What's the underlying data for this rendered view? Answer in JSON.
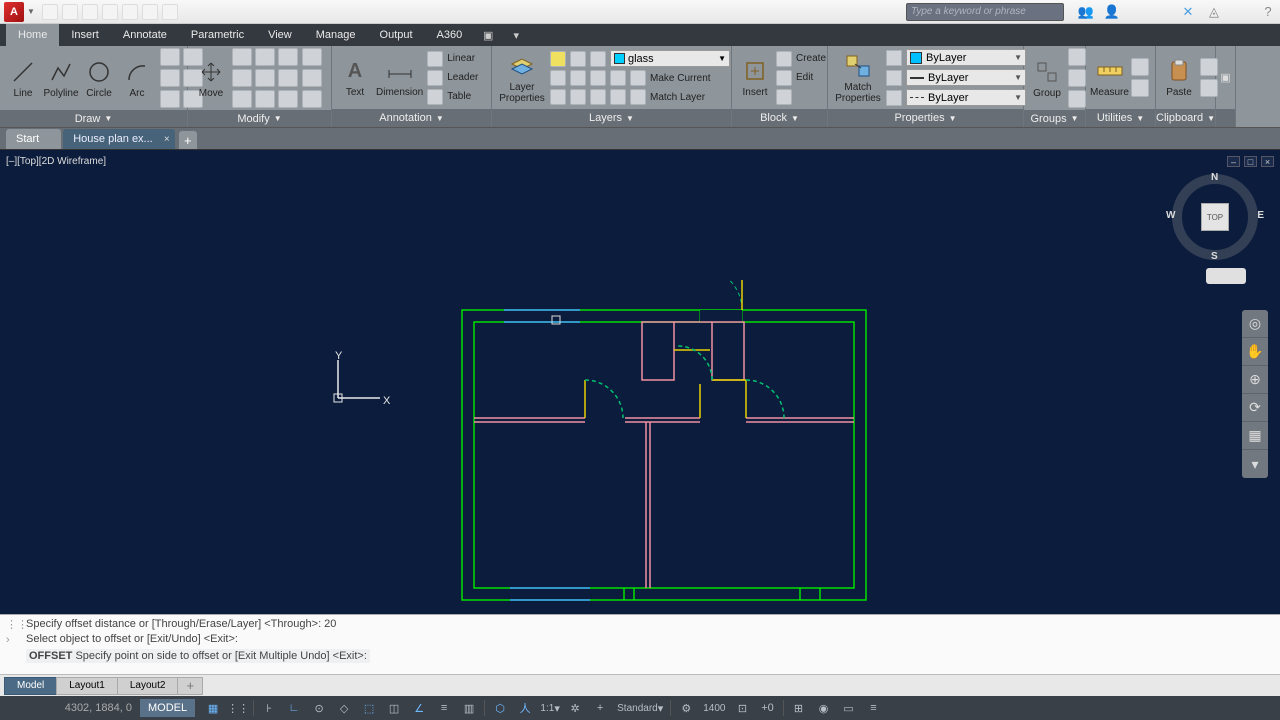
{
  "search": {
    "placeholder": "Type a keyword or phrase"
  },
  "menu": {
    "tabs": [
      "Home",
      "Insert",
      "Annotate",
      "Parametric",
      "View",
      "Manage",
      "Output",
      "A360"
    ]
  },
  "ribbon": {
    "draw": {
      "title": "Draw",
      "line": "Line",
      "polyline": "Polyline",
      "circle": "Circle",
      "arc": "Arc"
    },
    "modify": {
      "title": "Modify",
      "move": "Move"
    },
    "annotation": {
      "title": "Annotation",
      "text": "Text",
      "dimension": "Dimension",
      "linear": "Linear",
      "leader": "Leader",
      "table": "Table"
    },
    "layers": {
      "title": "Layers",
      "properties": "Layer\nProperties",
      "current_layer": "glass",
      "make_current": "Make Current",
      "match": "Match Layer"
    },
    "block": {
      "title": "Block",
      "insert": "Insert",
      "create": "Create",
      "edit": "Edit"
    },
    "properties": {
      "title": "Properties",
      "match": "Match\nProperties",
      "color": "ByLayer",
      "lw": "ByLayer",
      "lt": "ByLayer"
    },
    "groups": {
      "title": "Groups",
      "group": "Group"
    },
    "utilities": {
      "title": "Utilities",
      "measure": "Measure"
    },
    "clipboard": {
      "title": "Clipboard",
      "paste": "Paste"
    }
  },
  "doctabs": {
    "start": "Start",
    "file": "House plan ex...",
    "close": "×",
    "add": "+"
  },
  "view": {
    "label": "[–][Top][2D Wireframe]",
    "cube_face": "TOP",
    "n": "N",
    "s": "S",
    "e": "E",
    "w": "W"
  },
  "ucs": {
    "x": "X",
    "y": "Y"
  },
  "cmd": {
    "line1": "Specify offset distance or [Through/Erase/Layer] <Through>: 20",
    "line2": "Select object to offset or [Exit/Undo] <Exit>:",
    "line3_cmd": "OFFSET",
    "line3_rest": " Specify point on side to offset or [Exit Multiple Undo] <Exit>:"
  },
  "layouts": {
    "model": "Model",
    "l1": "Layout1",
    "l2": "Layout2",
    "add": "+"
  },
  "status": {
    "coords": "4302, 1884, 0",
    "mode": "MODEL",
    "scale": "1:1",
    "anno": "Standard",
    "num": "1400"
  }
}
